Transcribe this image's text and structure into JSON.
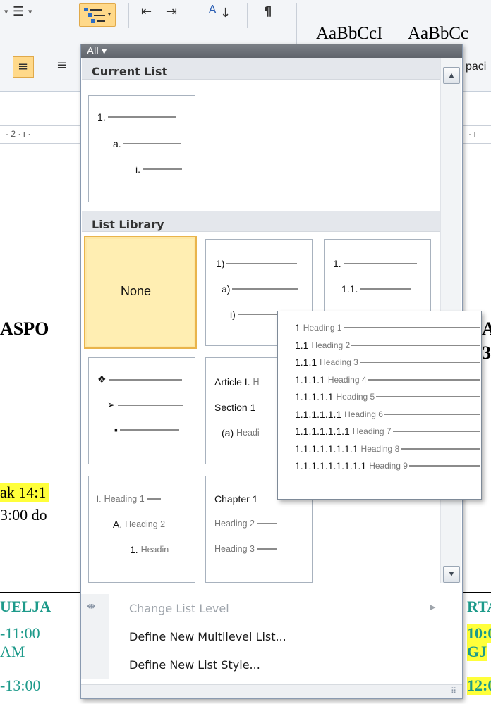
{
  "ribbon": {
    "style1": "AaBbCcI",
    "style2": "AaBbCc",
    "spacing_fragment": "paci"
  },
  "doc": {
    "aspo": "ASPO",
    "right_a": "A",
    "right_3": "3",
    "time_hl": "ak 14:1",
    "time_row": "3:00 do",
    "cell_uelja": "UELJA",
    "cell_1100": "-11:00",
    "cell_am": "AM",
    "cell_1300": "-13:00",
    "cell_rta": "RTA",
    "cell_100": "10:0",
    "cell_gj": "GJ",
    "cell_200": "12:0",
    "ruler_marks": "· 2 · ı ·"
  },
  "panel": {
    "filter_label": "All",
    "current_list_header": "Current List",
    "library_header": "List Library",
    "current": {
      "l1": "1.",
      "l2": "a.",
      "l3": "i."
    },
    "none_label": "None",
    "lib2": {
      "l1": "1)",
      "l2": "a)",
      "l3": "i)"
    },
    "lib3": {
      "l1": "1.",
      "l2": "1.1."
    },
    "lib4": {
      "l1": "❖",
      "l2": "➢",
      "l3": "▪"
    },
    "lib5": {
      "l1": "Article I.",
      "l1h": "H",
      "l2": "Section 1",
      "l3": "(a)",
      "l3h": "Headi"
    },
    "lib7": {
      "l1": "I.",
      "l1h": "Heading 1",
      "l2": "A.",
      "l2h": "Heading 2",
      "l3": "1.",
      "l3h": "Headin"
    },
    "lib8": {
      "l1": "Chapter 1",
      "l2h": "Heading 2",
      "l3h": "Heading 3"
    },
    "menu": {
      "change_level": "Change List Level",
      "define_multilevel": "Define New Multilevel List...",
      "define_style": "Define New List Style..."
    }
  },
  "tooltip": {
    "rows": [
      {
        "num": "1",
        "head": "Heading 1"
      },
      {
        "num": "1.1",
        "head": "Heading 2"
      },
      {
        "num": "1.1.1",
        "head": "Heading 3"
      },
      {
        "num": "1.1.1.1",
        "head": "Heading 4"
      },
      {
        "num": "1.1.1.1.1",
        "head": "Heading 5"
      },
      {
        "num": "1.1.1.1.1.1",
        "head": "Heading 6"
      },
      {
        "num": "1.1.1.1.1.1.1",
        "head": "Heading 7"
      },
      {
        "num": "1.1.1.1.1.1.1.1",
        "head": "Heading 8"
      },
      {
        "num": "1.1.1.1.1.1.1.1.1",
        "head": "Heading 9"
      }
    ]
  }
}
